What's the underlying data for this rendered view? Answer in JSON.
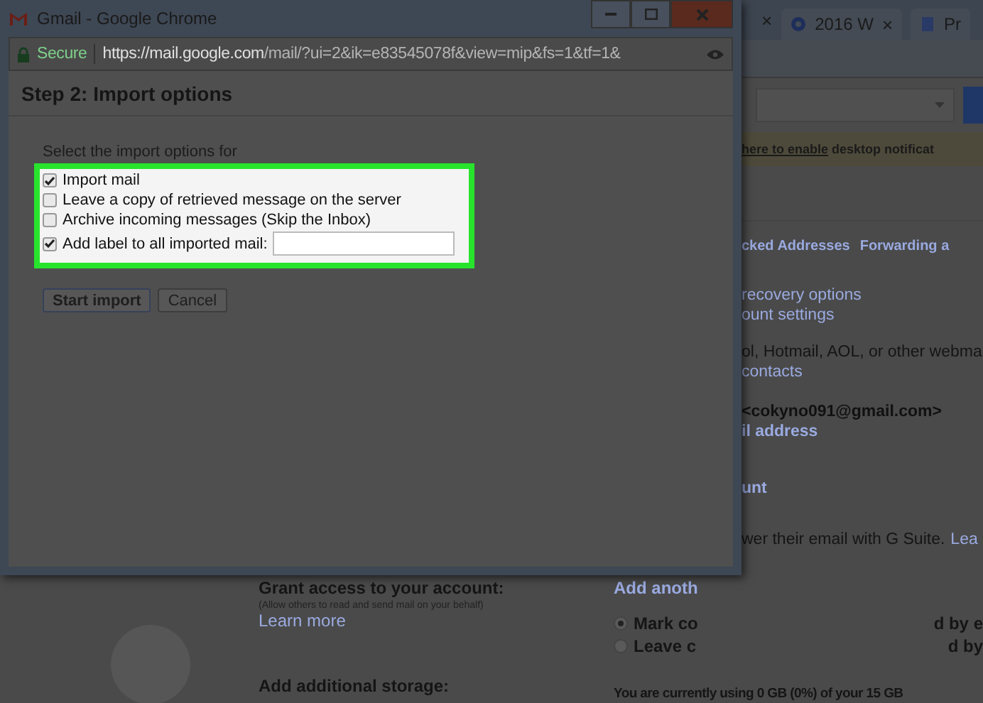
{
  "browser_tabs": {
    "leading_close": "×",
    "tabs": [
      {
        "label": "2016 W",
        "close": "×"
      },
      {
        "label": "Pr"
      }
    ]
  },
  "settings_page": {
    "notification": {
      "link": "here to enable",
      "text": "desktop notificat"
    },
    "tabs": [
      {
        "label": "cked Addresses"
      },
      {
        "label": "Forwarding a"
      }
    ],
    "sections": [
      [
        [
          {
            "kind": "link",
            "text": "recovery options"
          }
        ],
        [
          {
            "kind": "link",
            "text": "ount settings"
          }
        ]
      ],
      [
        [
          {
            "kind": "text",
            "text": "ol, Hotmail, AOL, or other webma"
          }
        ],
        [
          {
            "kind": "link",
            "text": "contacts"
          }
        ]
      ],
      [
        [
          {
            "kind": "strong",
            "text": "<cokyno091@gmail.com>"
          }
        ],
        [
          {
            "kind": "strong-link",
            "text": "il address"
          }
        ]
      ],
      [
        [
          {
            "kind": "strong-link",
            "text": "unt"
          }
        ]
      ],
      [
        [
          {
            "kind": "text",
            "text": "wer their email with G Suite."
          },
          {
            "kind": "link",
            "text": "Lea"
          }
        ]
      ]
    ],
    "grant": {
      "title": "Grant access to your account:",
      "note": "(Allow others to read and send mail on your behalf)",
      "link": "Learn more"
    },
    "storage_title": "Add additional storage:",
    "add_link": "Add anoth",
    "radios": [
      {
        "label": "Mark co",
        "tail": "d by e",
        "selected": true
      },
      {
        "label": "Leave c",
        "tail": "d by",
        "selected": false
      }
    ],
    "usage": "You are currently using 0 GB (0%) of your 15 GB"
  },
  "popup": {
    "title": "Gmail - Google Chrome",
    "secure_label": "Secure",
    "url_origin": "https://mail.google.com",
    "url_path": "/mail/?ui=2&ik=e83545078f&view=mip&fs=1&tf=1&",
    "heading": "Step 2: Import options",
    "intro": "Select the import options for",
    "options": [
      {
        "kind": "checkbox",
        "label": "Import mail",
        "checked": true
      },
      {
        "kind": "checkbox",
        "label": "Leave a copy of retrieved message on the server",
        "checked": false
      },
      {
        "kind": "checkbox",
        "label": "Archive incoming messages (Skip the Inbox)",
        "checked": false
      },
      {
        "kind": "checkbox-field",
        "label": "Add label to all imported mail:",
        "checked": true
      }
    ],
    "buttons": [
      {
        "kind": "default",
        "label": "Start import"
      },
      {
        "kind": "plain",
        "label": "Cancel"
      }
    ]
  }
}
